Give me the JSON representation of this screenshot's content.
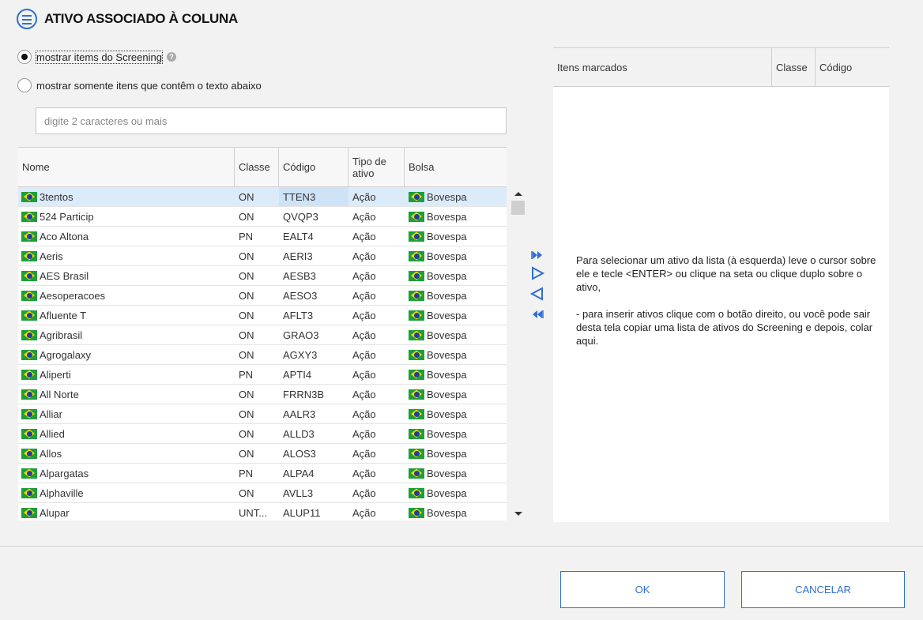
{
  "dialog": {
    "title": "ATIVO ASSOCIADO À COLUNA",
    "title_icon": "list-icon"
  },
  "options": {
    "screening_label": "mostrar items do Screening",
    "screening_selected": true,
    "filter_label": "mostrar somente itens que contêm o texto abaixo",
    "filter_selected": false,
    "help_glyph": "?"
  },
  "search": {
    "placeholder": "digite 2 caracteres ou mais",
    "value": ""
  },
  "list": {
    "headers": {
      "nome": "Nome",
      "classe": "Classe",
      "codigo": "Código",
      "tipo": "Tipo de ativo",
      "bolsa": "Bolsa"
    },
    "selected_index": 0,
    "rows": [
      {
        "nome": "3tentos",
        "classe": "ON",
        "codigo": "TTEN3",
        "tipo": "Ação",
        "bolsa": "Bovespa"
      },
      {
        "nome": "524 Particip",
        "classe": "ON",
        "codigo": "QVQP3",
        "tipo": "Ação",
        "bolsa": "Bovespa"
      },
      {
        "nome": "Aco Altona",
        "classe": "PN",
        "codigo": "EALT4",
        "tipo": "Ação",
        "bolsa": "Bovespa"
      },
      {
        "nome": "Aeris",
        "classe": "ON",
        "codigo": "AERI3",
        "tipo": "Ação",
        "bolsa": "Bovespa"
      },
      {
        "nome": "AES Brasil",
        "classe": "ON",
        "codigo": "AESB3",
        "tipo": "Ação",
        "bolsa": "Bovespa"
      },
      {
        "nome": "Aesoperacoes",
        "classe": "ON",
        "codigo": "AESO3",
        "tipo": "Ação",
        "bolsa": "Bovespa"
      },
      {
        "nome": "Afluente T",
        "classe": "ON",
        "codigo": "AFLT3",
        "tipo": "Ação",
        "bolsa": "Bovespa"
      },
      {
        "nome": "Agribrasil",
        "classe": "ON",
        "codigo": "GRAO3",
        "tipo": "Ação",
        "bolsa": "Bovespa"
      },
      {
        "nome": "Agrogalaxy",
        "classe": "ON",
        "codigo": "AGXY3",
        "tipo": "Ação",
        "bolsa": "Bovespa"
      },
      {
        "nome": "Aliperti",
        "classe": "PN",
        "codigo": "APTI4",
        "tipo": "Ação",
        "bolsa": "Bovespa"
      },
      {
        "nome": "All Norte",
        "classe": "ON",
        "codigo": "FRRN3B",
        "tipo": "Ação",
        "bolsa": "Bovespa"
      },
      {
        "nome": "Alliar",
        "classe": "ON",
        "codigo": "AALR3",
        "tipo": "Ação",
        "bolsa": "Bovespa"
      },
      {
        "nome": "Allied",
        "classe": "ON",
        "codigo": "ALLD3",
        "tipo": "Ação",
        "bolsa": "Bovespa"
      },
      {
        "nome": "Allos",
        "classe": "ON",
        "codigo": "ALOS3",
        "tipo": "Ação",
        "bolsa": "Bovespa"
      },
      {
        "nome": "Alpargatas",
        "classe": "PN",
        "codigo": "ALPA4",
        "tipo": "Ação",
        "bolsa": "Bovespa"
      },
      {
        "nome": "Alphaville",
        "classe": "ON",
        "codigo": "AVLL3",
        "tipo": "Ação",
        "bolsa": "Bovespa"
      },
      {
        "nome": "Alupar",
        "classe": "UNT...",
        "codigo": "ALUP11",
        "tipo": "Ação",
        "bolsa": "Bovespa"
      }
    ]
  },
  "transfer_buttons": [
    {
      "name": "add-all-button",
      "icon": "double-arrow-right-icon"
    },
    {
      "name": "add-button",
      "icon": "arrow-right-icon"
    },
    {
      "name": "remove-button",
      "icon": "arrow-left-icon"
    },
    {
      "name": "remove-all-button",
      "icon": "double-arrow-left-icon"
    }
  ],
  "marked": {
    "headers": {
      "itens": "Itens marcados",
      "classe": "Classe",
      "codigo": "Código"
    },
    "help_p1": "Para selecionar um ativo da lista (à esquerda) leve o cursor sobre ele e tecle <ENTER> ou clique na seta ou clique duplo sobre o ativo,",
    "help_p2": "- para inserir ativos clique com o botão direito, ou você pode sair desta tela copiar uma lista de ativos do Screening e depois, colar aqui."
  },
  "footer": {
    "ok_label": "OK",
    "cancel_label": "CANCELAR"
  },
  "colors": {
    "accent": "#2f6fd6",
    "selected_row": "#dcebfa",
    "flag_green": "#1e9e3a"
  }
}
